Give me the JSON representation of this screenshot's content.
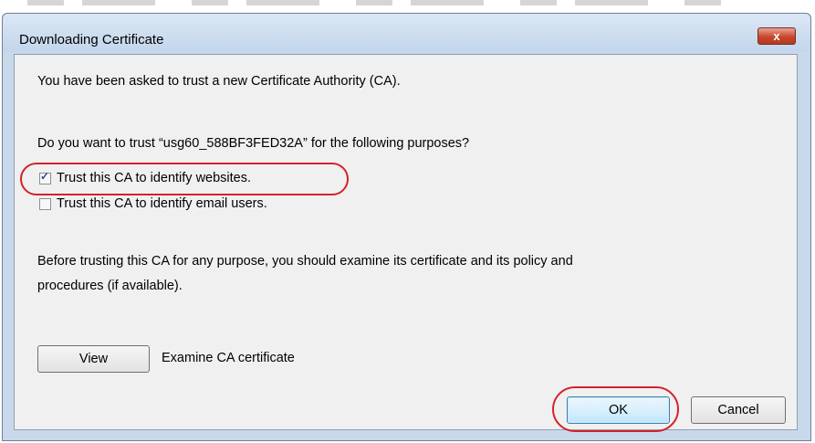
{
  "dialog": {
    "title": "Downloading Certificate",
    "close_symbol": "x",
    "close_icon": "close-icon",
    "intro_text": "You have been asked to trust a new Certificate Authority (CA).",
    "question_text": "Do you want to trust “usg60_588BF3FED32A” for the following purposes?",
    "options": [
      {
        "label": "Trust this CA to identify websites.",
        "checked": true
      },
      {
        "label": "Trust this CA to identify email users.",
        "checked": false
      }
    ],
    "advice_line1": "Before trusting this CA for any purpose, you should examine its certificate and its policy and",
    "advice_line2": "procedures (if available).",
    "view_label": "View",
    "view_description": "Examine CA certificate",
    "ok_label": "OK",
    "cancel_label": "Cancel",
    "highlight_color": "#d6202b",
    "check_symbol": "✓"
  }
}
